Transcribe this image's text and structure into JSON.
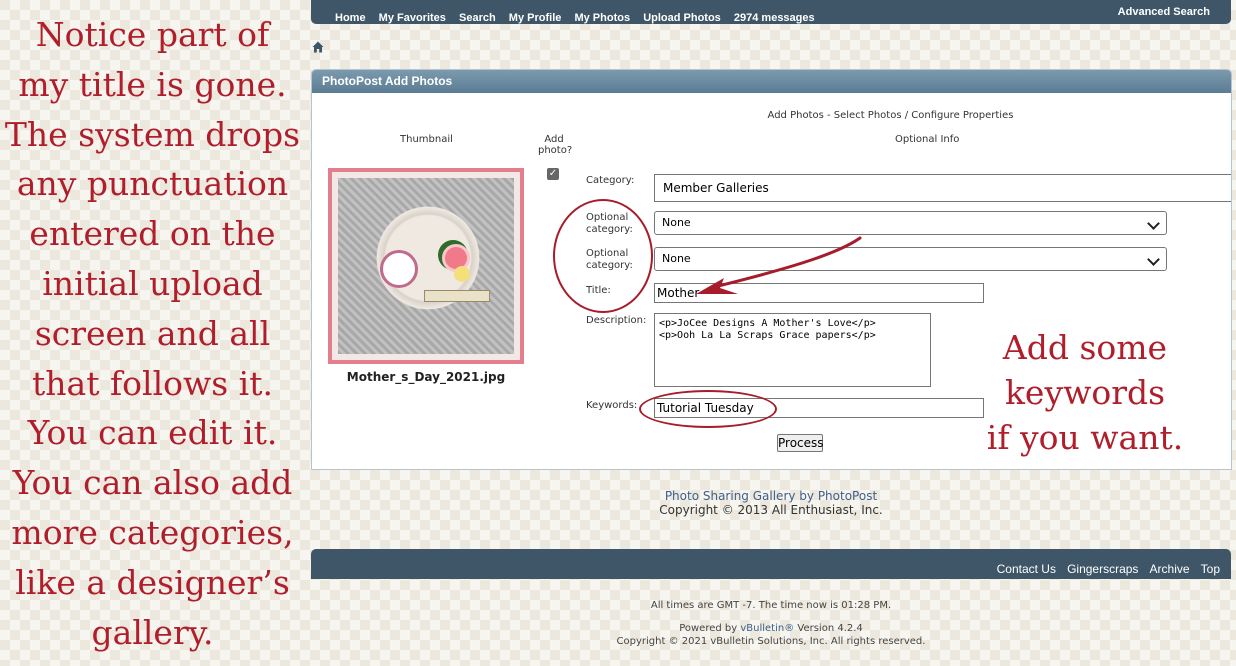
{
  "annotation_left": {
    "lines": [
      "Notice part of",
      "my title is gone.",
      "The system drops",
      "any punctuation",
      "entered on the",
      "initial upload",
      "screen and all",
      "that follows it.",
      "You can edit it.",
      "You can also add",
      "more categories,",
      "like a designer’s",
      "gallery."
    ]
  },
  "annotation_right": {
    "lines": [
      "Add some",
      "keywords",
      "if you want."
    ]
  },
  "navbar": {
    "items": [
      "Home",
      "My Favorites",
      "Search",
      "My Profile",
      "My Photos",
      "Upload Photos",
      "2974 messages"
    ],
    "advanced_search": "Advanced Search"
  },
  "icons": {
    "home": "home-icon"
  },
  "panel": {
    "title": "PhotoPost Add Photos",
    "subtitle": "Add Photos - Select Photos / Configure Properties",
    "col_thumbnail": "Thumbnail",
    "col_add_photo": "Add photo?",
    "col_optional_info": "Optional Info",
    "filename": "Mother_s_Day_2021.jpg",
    "add_photo_checked": true
  },
  "form": {
    "category_label": "Category:",
    "category_value": "Member Galleries",
    "opt_cat1_label": "Optional category:",
    "opt_cat1_value": "None",
    "opt_cat2_label": "Optional category:",
    "opt_cat2_value": "None",
    "title_label": "Title:",
    "title_value": "Mother",
    "description_label": "Description:",
    "description_value": "<p>JoCee Designs A Mother's Love</p>\n<p>Ooh La La Scraps Grace papers</p>",
    "keywords_label": "Keywords:",
    "keywords_value": "Tutorial Tuesday",
    "process_button": "Process"
  },
  "footer": {
    "gallery_link": "Photo Sharing Gallery by PhotoPost",
    "copyright": "Copyright © 2013 All Enthusiast, Inc."
  },
  "bottombar": {
    "links": [
      "Contact Us",
      "Gingerscraps",
      "Archive",
      "Top"
    ]
  },
  "page_footer": {
    "time_text": "All times are GMT -7. The time now is 01:28 PM.",
    "powered_prefix": "Powered by ",
    "powered_link": "vBulletin®",
    "powered_suffix": " Version 4.2.4",
    "copyright": "Copyright © 2021 vBulletin Solutions, Inc. All rights reserved."
  },
  "colors": {
    "annotation": "#b01e2c",
    "navbar": "#3e5668",
    "panel_header": "#6b8aa0",
    "link": "#3f5f8a"
  }
}
